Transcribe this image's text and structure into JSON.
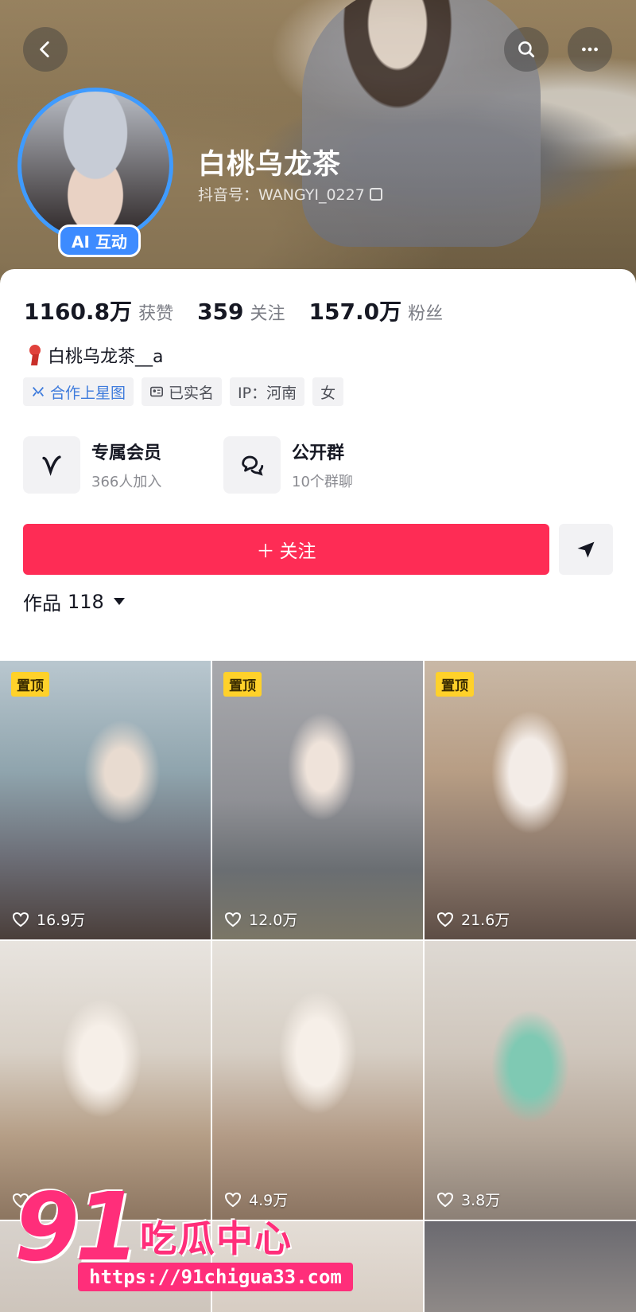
{
  "header": {
    "name": "白桃乌龙茶",
    "douyin_id": "抖音号：WANGYI_0227",
    "ai_badge": "AI 互动"
  },
  "stats": [
    {
      "value": "1160.8万",
      "label": "获赞"
    },
    {
      "value": "359",
      "label": "关注"
    },
    {
      "value": "157.0万",
      "label": "粉丝"
    }
  ],
  "signature": "白桃乌龙茶__a",
  "tags": [
    "合作上星图",
    "已实名",
    "IP：河南",
    "女"
  ],
  "services": [
    {
      "title": "专属会员",
      "subtitle": "366人加入"
    },
    {
      "title": "公开群",
      "subtitle": "10个群聊"
    }
  ],
  "follow_label": "关注",
  "works": {
    "label": "作品",
    "count": "118"
  },
  "pin_label": "置顶",
  "videos": [
    {
      "pinned": true,
      "likes": "16.9万"
    },
    {
      "pinned": true,
      "likes": "12.0万"
    },
    {
      "pinned": true,
      "likes": "21.6万"
    },
    {
      "pinned": false,
      "likes": ""
    },
    {
      "pinned": false,
      "likes": "4.9万"
    },
    {
      "pinned": false,
      "likes": "3.8万"
    }
  ],
  "watermark": {
    "number": "91",
    "text": "吃瓜中心",
    "url": "https://91chigua33.com"
  },
  "colors": {
    "accent": "#fe2c55",
    "badge_blue": "#3d8bff",
    "pin_yellow": "#ffd12a",
    "watermark_pink": "#ff2e7a"
  }
}
